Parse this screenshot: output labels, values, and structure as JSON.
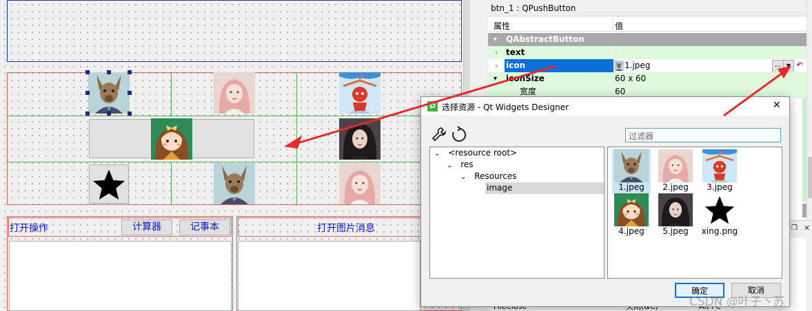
{
  "designer": {
    "buttons": {
      "calculator_label": "计算器",
      "notepad_label": "记事本"
    },
    "labels": {
      "open_action": "打开操作",
      "open_image_message": "打开图片消息"
    }
  },
  "property_editor": {
    "header_title": "btn_1 : QPushButton",
    "col_property": "属性",
    "col_value": "值",
    "group": "QAbstractButton",
    "rows": [
      {
        "name": "text",
        "value": ""
      },
      {
        "name": "icon",
        "value": "1.jpeg"
      },
      {
        "name": "iconSize",
        "value": "60 x 60"
      },
      {
        "name": "宽度",
        "value": "60"
      }
    ],
    "ellipsis_label": "...",
    "bottom_row": {
      "name": "FileClose",
      "value": "关闭(&C)",
      "shortcut": "Alt+C"
    }
  },
  "dialog": {
    "title": "选择资源 - Qt Widgets Designer",
    "filter_placeholder": "过滤器",
    "tree": [
      "<resource root>",
      "res",
      "Resources",
      "image"
    ],
    "thumbnails": [
      "1.jpeg",
      "2.jpeg",
      "3.jpeg",
      "4.jpeg",
      "5.jpeg",
      "xing.png"
    ],
    "ok_label": "确定",
    "cancel_label": "取消"
  },
  "watermark": "CSDN @叶子丶苏",
  "colors": {
    "accent_red": "#e8282b",
    "selection_blue": "#0a6fd6",
    "prop_green": "#ddfadd",
    "group_grey": "#a8a8a8",
    "widget_blue_text": "#1111cc"
  },
  "icons": [
    "kangaroo-image",
    "girl-portrait-image",
    "hanger-mascot-image",
    "cartoon-girl-image",
    "dark-hair-girl-image",
    "star-icon",
    "wrench-icon",
    "refresh-icon",
    "close-icon",
    "expand-arrow-icon",
    "dropdown-arrow-icon",
    "reset-arrow-icon"
  ]
}
